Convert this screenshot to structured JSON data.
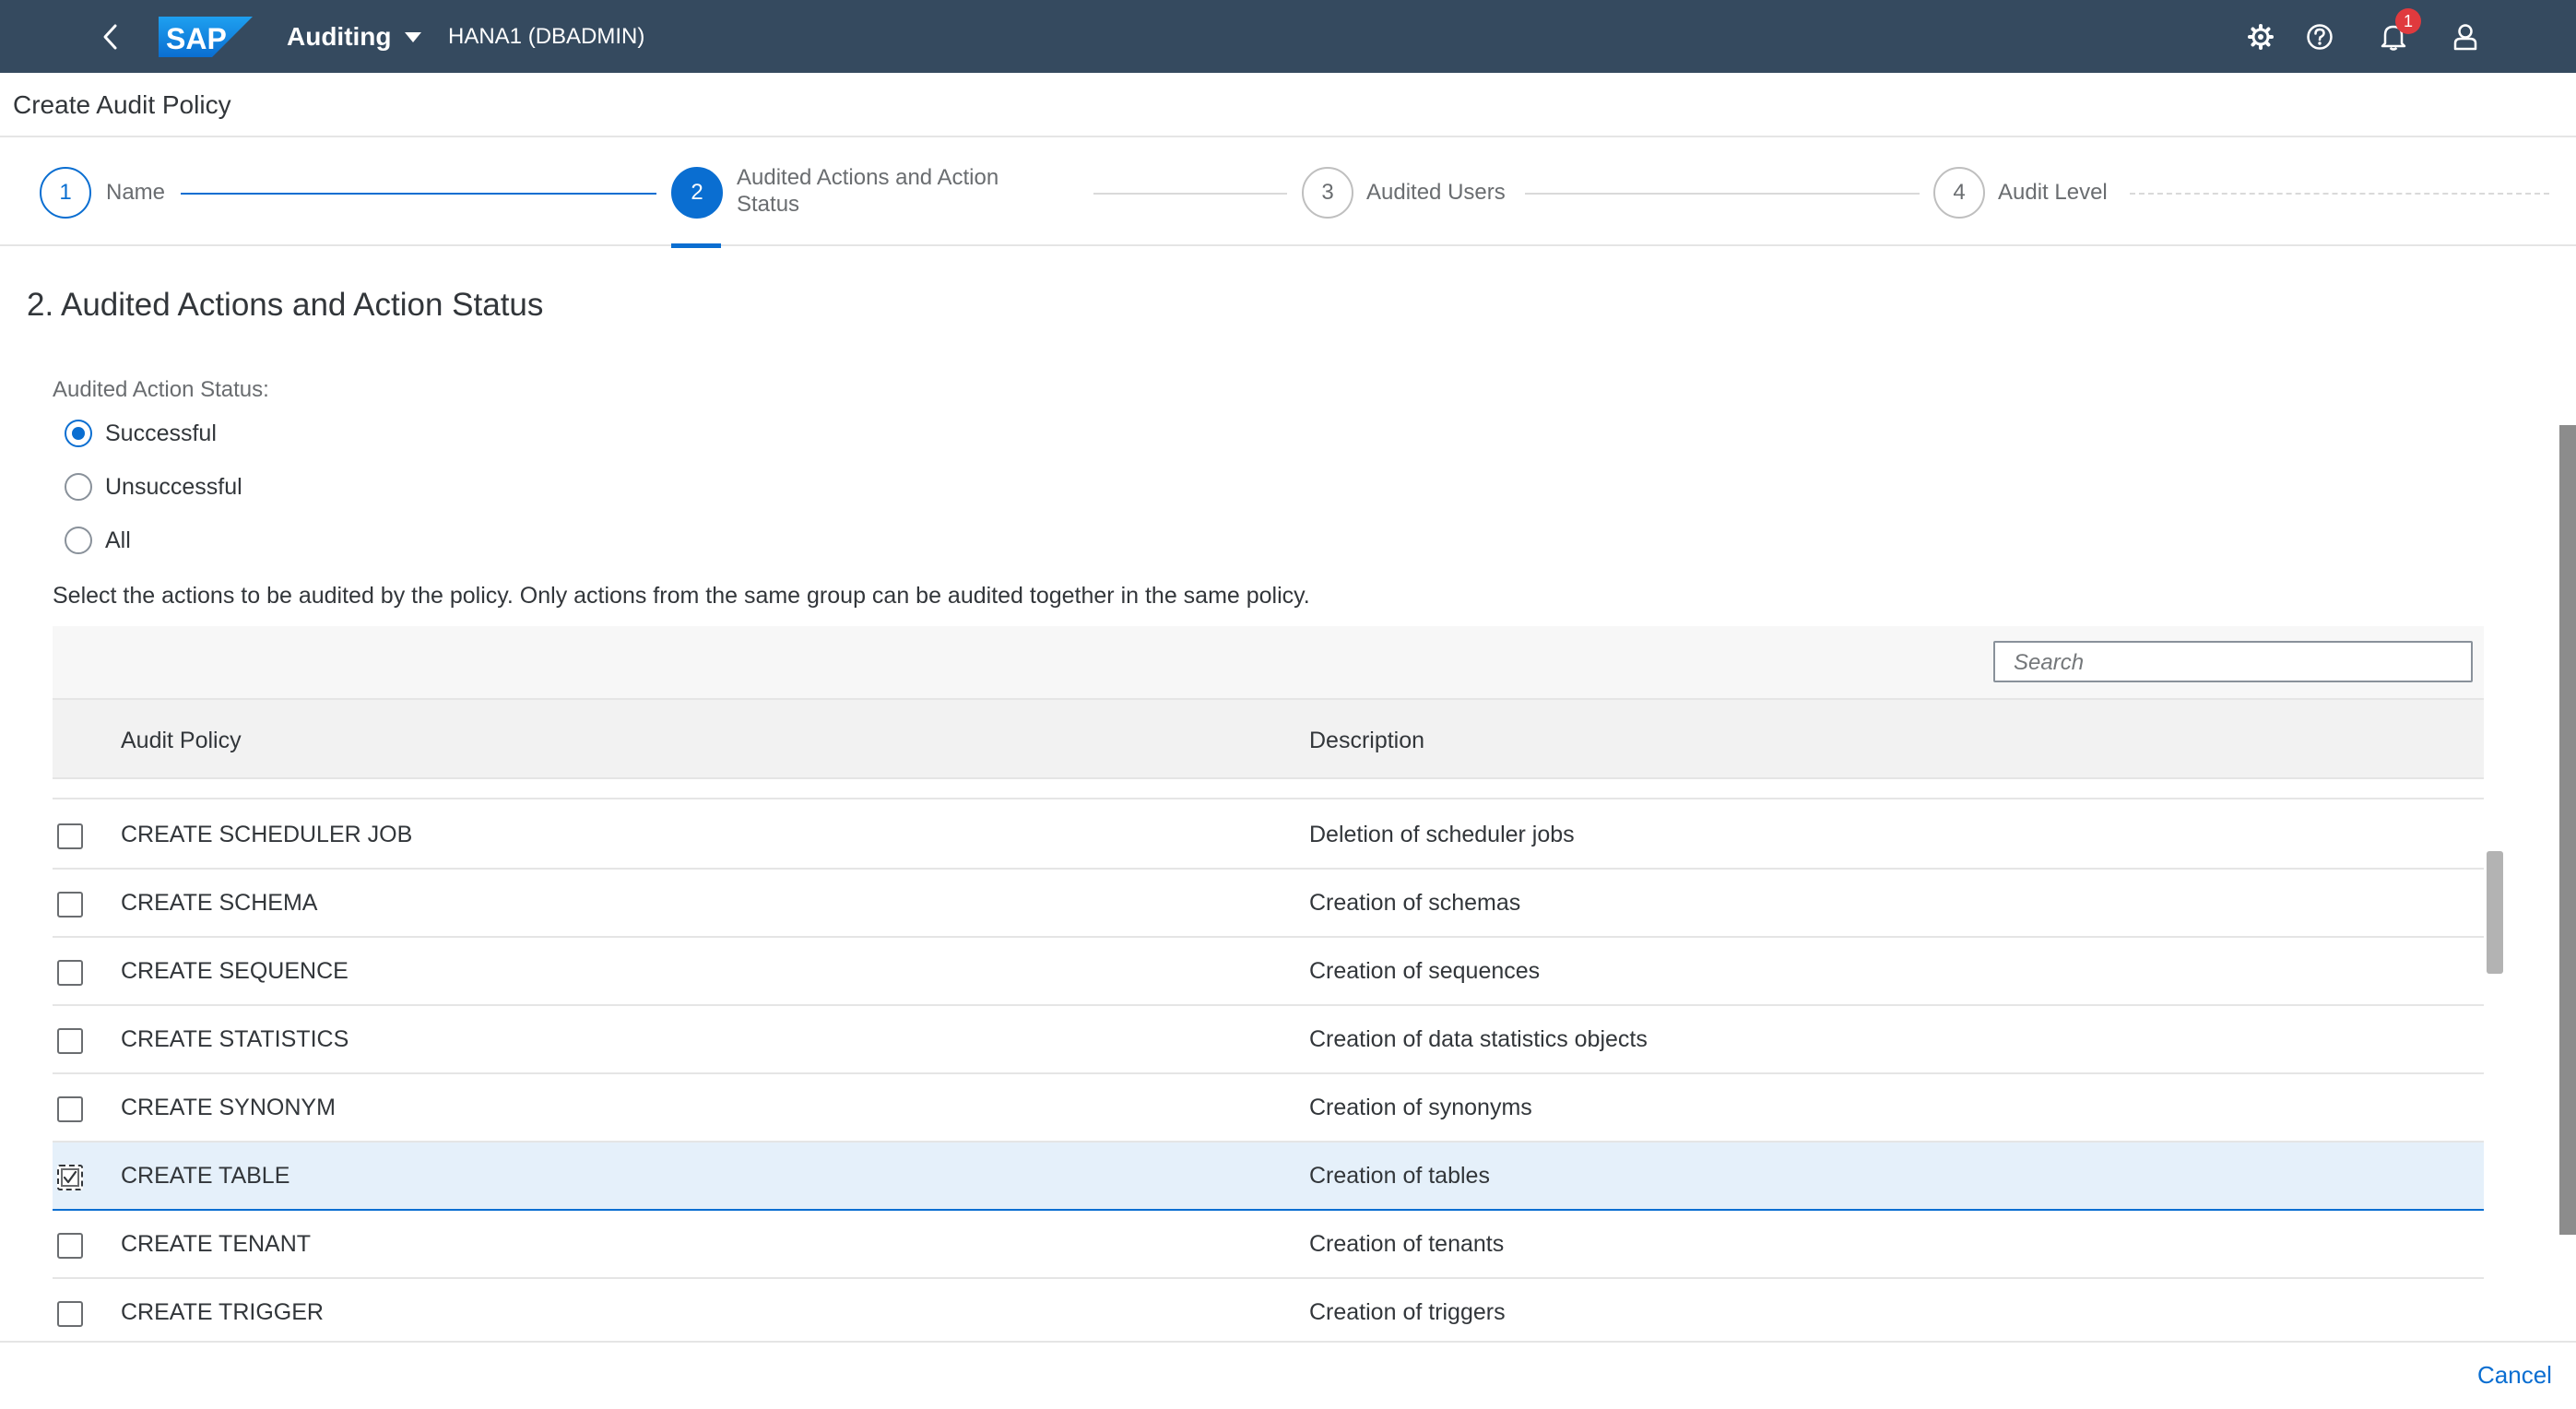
{
  "shell": {
    "logo_text": "SAP",
    "app_title": "Auditing",
    "system": "HANA1 (DBADMIN)",
    "notification_count": "1",
    "colors": {
      "shell_bg": "#354a5f",
      "accent": "#0a6ed1",
      "badge": "#e03a3e"
    }
  },
  "page": {
    "title": "Create Audit Policy"
  },
  "wizard": {
    "steps": [
      {
        "number": "1",
        "label": "Name",
        "state": "completed"
      },
      {
        "number": "2",
        "label_line1": "Audited Actions and Action",
        "label_line2": "Status",
        "state": "active"
      },
      {
        "number": "3",
        "label": "Audited Users",
        "state": "future"
      },
      {
        "number": "4",
        "label": "Audit Level",
        "state": "future"
      }
    ]
  },
  "section": {
    "title": "2. Audited Actions and Action Status",
    "status_label": "Audited Action Status:",
    "radios": [
      {
        "label": "Successful",
        "checked": true
      },
      {
        "label": "Unsuccessful",
        "checked": false
      },
      {
        "label": "All",
        "checked": false
      }
    ],
    "hint": "Select the actions to be audited by the policy. Only actions from the same group can be audited together in the same policy."
  },
  "table": {
    "search_placeholder": "Search",
    "columns": [
      "Audit Policy",
      "Description"
    ],
    "rows": [
      {
        "name": "CREATE SCHEDULER JOB",
        "description": "Deletion of scheduler jobs",
        "checked": false
      },
      {
        "name": "CREATE SCHEMA",
        "description": "Creation of schemas",
        "checked": false
      },
      {
        "name": "CREATE SEQUENCE",
        "description": "Creation of sequences",
        "checked": false
      },
      {
        "name": "CREATE STATISTICS",
        "description": "Creation of data statistics objects",
        "checked": false
      },
      {
        "name": "CREATE SYNONYM",
        "description": "Creation of synonyms",
        "checked": false
      },
      {
        "name": "CREATE TABLE",
        "description": "Creation of tables",
        "checked": true
      },
      {
        "name": "CREATE TENANT",
        "description": "Creation of tenants",
        "checked": false
      },
      {
        "name": "CREATE TRIGGER",
        "description": "Creation of triggers",
        "checked": false
      }
    ]
  },
  "footer": {
    "cancel_label": "Cancel"
  }
}
